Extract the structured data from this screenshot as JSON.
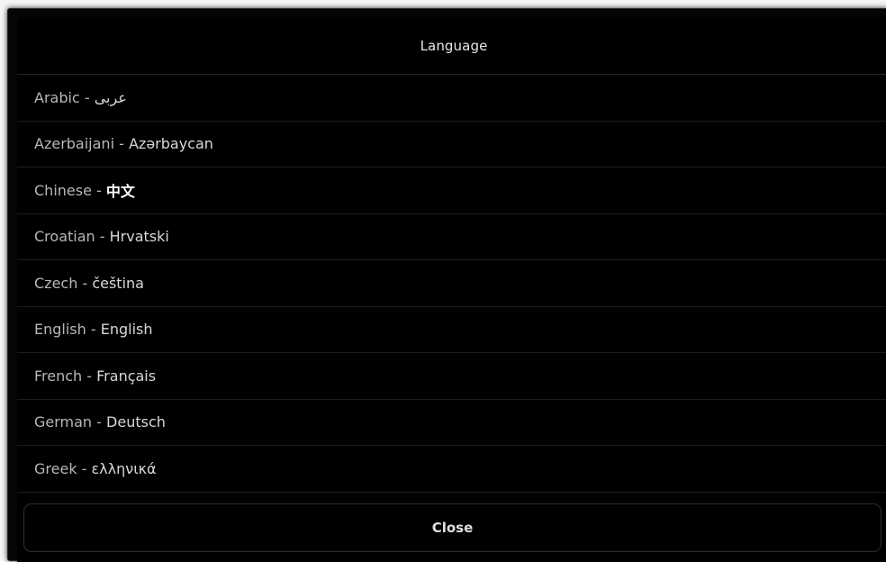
{
  "dialog": {
    "title": "Language",
    "close_label": "Close"
  },
  "languages": [
    {
      "name": "Arabic",
      "separator": " - ",
      "native": "عربى"
    },
    {
      "name": "Azerbaijani",
      "separator": " - ",
      "native": "Azərbaycan"
    },
    {
      "name": "Chinese",
      "separator": " - ",
      "native": "中文"
    },
    {
      "name": "Croatian",
      "separator": " - ",
      "native": "Hrvatski"
    },
    {
      "name": "Czech",
      "separator": " - ",
      "native": "čeština"
    },
    {
      "name": "English",
      "separator": " - ",
      "native": "English"
    },
    {
      "name": "French",
      "separator": " - ",
      "native": "Français"
    },
    {
      "name": "German",
      "separator": " - ",
      "native": "Deutsch"
    },
    {
      "name": "Greek",
      "separator": " - ",
      "native": "ελληνικά"
    }
  ],
  "colors": {
    "dialog_background": "#000000",
    "divider": "#1c1c1c",
    "text": "#b7b7b7",
    "title_text": "#e6e6e6"
  }
}
